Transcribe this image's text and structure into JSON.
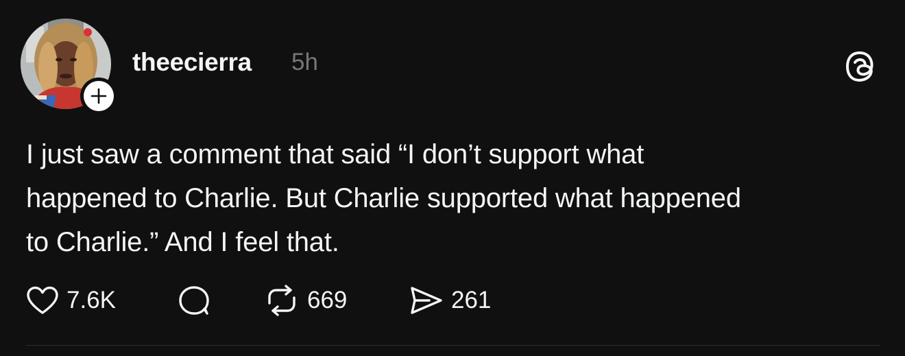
{
  "post": {
    "author": {
      "username": "theecierra",
      "avatar_icon": "profile-photo",
      "follow_icon": "plus-icon"
    },
    "timestamp": "5h",
    "app_logo_icon": "threads-logo-icon",
    "text": "I just saw a comment that said “I don’t support what\nhappened to Charlie. But Charlie supported what happened\nto Charlie.” And I feel that.",
    "actions": {
      "like": {
        "icon": "heart-icon",
        "count": "7.6K"
      },
      "comment": {
        "icon": "comment-icon",
        "count": ""
      },
      "repost": {
        "icon": "repost-icon",
        "count": "669"
      },
      "share": {
        "icon": "share-icon",
        "count": "261"
      }
    }
  },
  "colors": {
    "background": "#101010",
    "text_primary": "#f3f5f7",
    "text_secondary": "#777777",
    "divider": "#2e2e2e"
  }
}
